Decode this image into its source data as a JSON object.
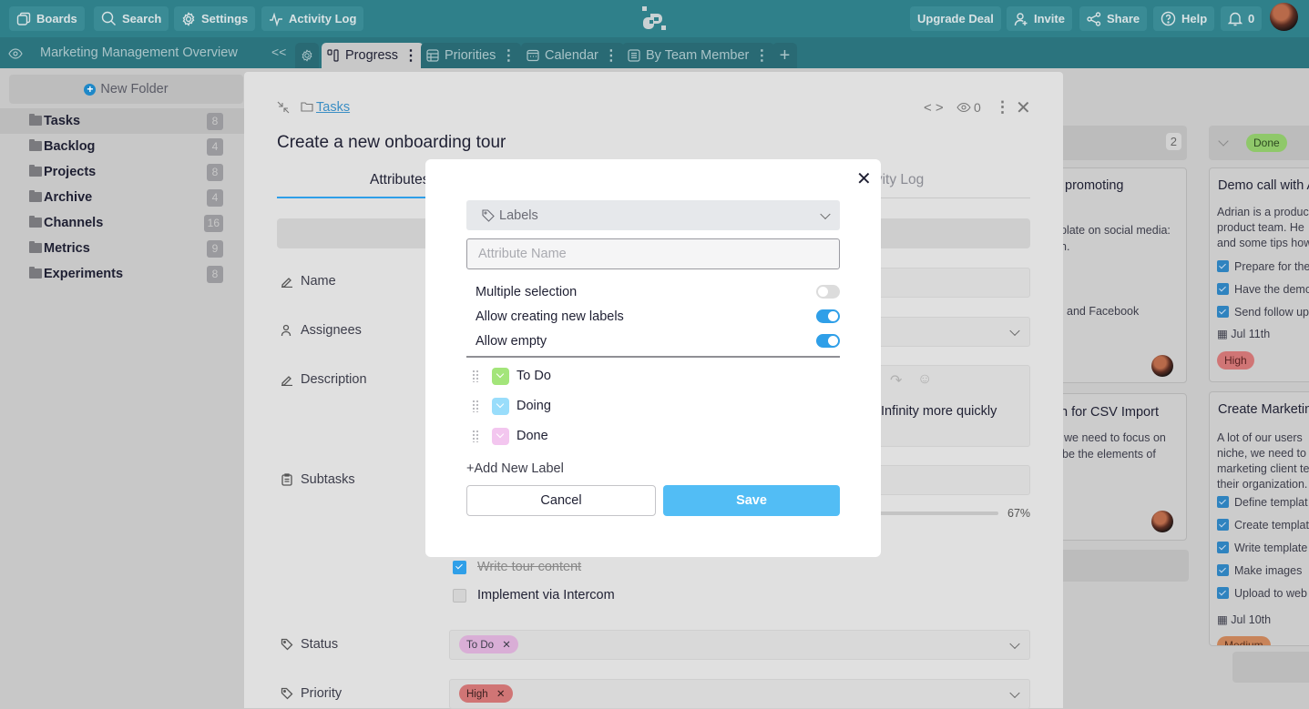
{
  "topbar": {
    "buttons": {
      "boards": "Boards",
      "search": "Search",
      "settings": "Settings",
      "activity_log": "Activity Log",
      "upgrade": "Upgrade Deal",
      "invite": "Invite",
      "share": "Share",
      "help": "Help",
      "notifications_count": "0"
    }
  },
  "tabbar": {
    "board_title": "Marketing Management Overview",
    "collapse": "<<",
    "tabs": [
      {
        "label": "Progress",
        "icon": "kanban-icon",
        "active": true
      },
      {
        "label": "Priorities",
        "icon": "table-icon",
        "active": false
      },
      {
        "label": "Calendar",
        "icon": "calendar-icon",
        "active": false
      },
      {
        "label": "By Team Member",
        "icon": "list-icon",
        "active": false
      }
    ],
    "add": "+"
  },
  "sidebar": {
    "new_folder": "New Folder",
    "folders": [
      {
        "name": "Tasks",
        "count": "8",
        "selected": true
      },
      {
        "name": "Backlog",
        "count": "4"
      },
      {
        "name": "Projects",
        "count": "8"
      },
      {
        "name": "Archive",
        "count": "4"
      },
      {
        "name": "Channels",
        "count": "16"
      },
      {
        "name": "Metrics",
        "count": "9"
      },
      {
        "name": "Experiments",
        "count": "8"
      }
    ]
  },
  "panel": {
    "breadcrumb": "Tasks",
    "watchers": "0",
    "title": "Create a new onboarding tour",
    "tabs": {
      "attributes": "Attributes",
      "activity_log": "Activity Log"
    },
    "fields": {
      "name": "Name",
      "assignees": "Assignees",
      "description": "Description",
      "description_text": "Infinity more quickly",
      "subtasks": "Subtasks",
      "progress_label": "67%",
      "progress": 0.67,
      "subtask_items": [
        {
          "text": "Write tour content",
          "done": true
        },
        {
          "text": "Implement via Intercom",
          "done": false
        }
      ],
      "status": "Status",
      "status_value": "To Do",
      "priority": "Priority",
      "priority_value": "High"
    }
  },
  "board": {
    "column1": {
      "count": "2",
      "cards": [
        {
          "title": "promoting",
          "lines": [
            "plate on social media:",
            "n.",
            "and Facebook"
          ]
        },
        {
          "title": "n for CSV Import",
          "lines": [
            "we need to focus on",
            "be the elements of"
          ]
        }
      ]
    },
    "column2": {
      "status": "Done",
      "cards": [
        {
          "title": "Demo call with A",
          "desc": [
            "Adrian is a produc",
            "product team. He",
            "and some tips how"
          ],
          "checks": [
            "Prepare for the",
            "Have the demo",
            "Send follow up"
          ],
          "date": "Jul 11th",
          "priority": "High"
        },
        {
          "title": "Create Marketin",
          "desc": [
            "A lot of our users",
            "niche, we need to",
            "marketing client te",
            "their organization."
          ],
          "checks": [
            "Define templat",
            "Create templat",
            "Write template",
            "Make images",
            "Upload to web"
          ],
          "date": "Jul 10th",
          "priority": "Medium"
        }
      ]
    }
  },
  "modal": {
    "type_select": "Labels",
    "name_placeholder": "Attribute Name",
    "options": [
      {
        "label": "Multiple selection",
        "enabled": false
      },
      {
        "label": "Allow creating new labels",
        "enabled": true
      },
      {
        "label": "Allow empty",
        "enabled": true
      }
    ],
    "labels": [
      {
        "name": "To Do",
        "color": "#a3e57a"
      },
      {
        "name": "Doing",
        "color": "#99ddfb"
      },
      {
        "name": "Done",
        "color": "#f3c6ef"
      }
    ],
    "add_label": "+Add New Label",
    "cancel": "Cancel",
    "save": "Save"
  },
  "colors": {
    "topbar": "#2f808a",
    "accent": "#2f9fe8",
    "save": "#52bdf5",
    "status_todo": "#d9aed6",
    "priority_high": "#d07575",
    "done_pill": "#8fc86a",
    "medium": "#c8845a"
  }
}
